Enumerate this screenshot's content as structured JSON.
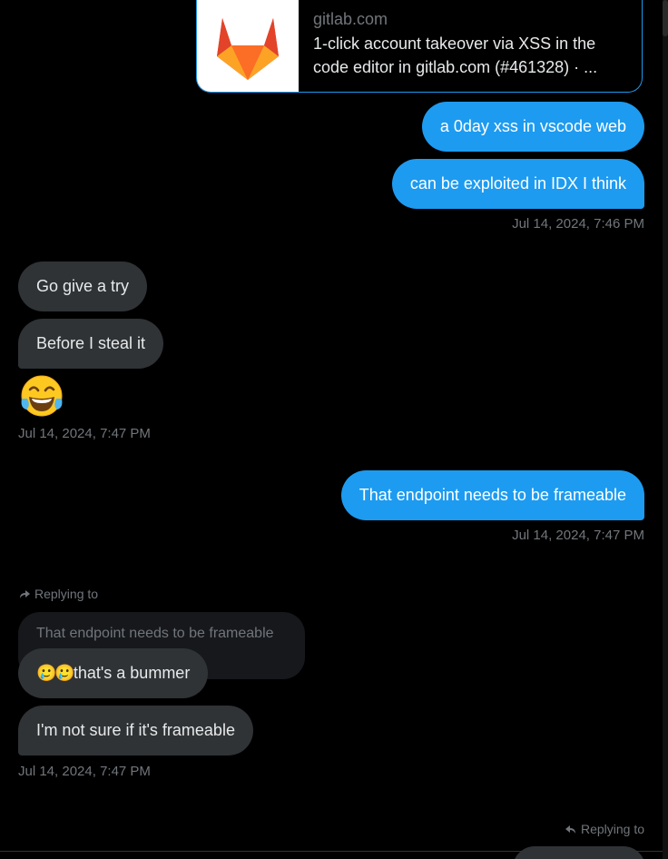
{
  "link_card": {
    "domain": "gitlab.com",
    "title_line1": "1-click account takeover via XSS in the",
    "title_line2": "code editor in gitlab.com (#461328) · ...",
    "icon": "gitlab-logo"
  },
  "messages": {
    "sent1": "a 0day xss in vscode web",
    "sent2": "can be exploited in IDX I think",
    "ts1": "Jul 14, 2024, 7:46 PM",
    "recv1": "Go give a try",
    "recv2": "Before I steal it",
    "recv3_emoji": "😂",
    "ts2": "Jul 14, 2024, 7:47 PM",
    "sent3": "That endpoint needs to be frameable",
    "ts3": "Jul 14, 2024, 7:47 PM",
    "reply_label": "Replying to",
    "quoted_text": "That endpoint needs to be frameable",
    "recv4_text": "that's a bummer",
    "recv4_emoji": "🥲🥲",
    "recv5": "I'm not sure if it's frameable",
    "ts4": "Jul 14, 2024, 7:47 PM",
    "reply_label2": "Replying to"
  },
  "colors": {
    "sent_bubble": "#1d9bf0",
    "recv_bubble": "#2f3336",
    "background": "#000000",
    "muted_text": "#71767b"
  }
}
